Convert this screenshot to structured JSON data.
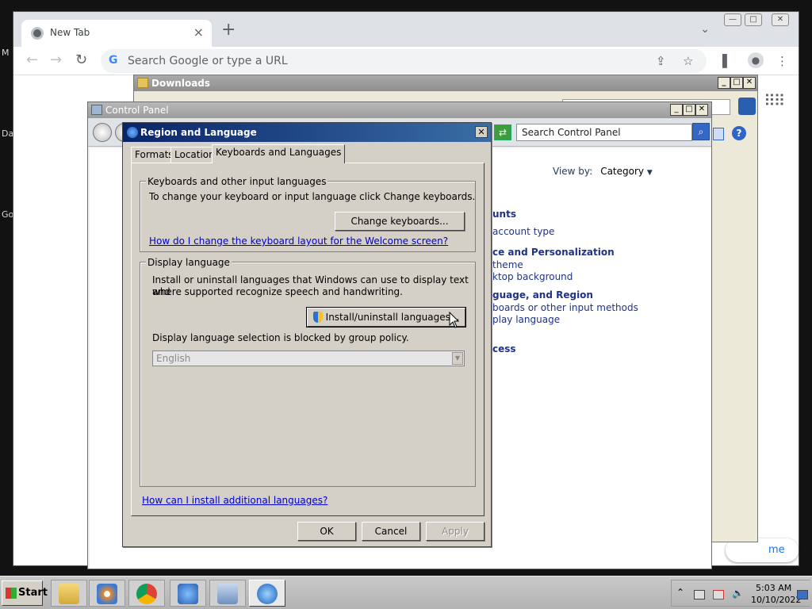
{
  "desktop": {
    "labels": [
      "M",
      "Da",
      "Go"
    ]
  },
  "chrome": {
    "tab_title": "New Tab",
    "new_tab": "+",
    "omnibox_placeholder": "Search Google or type a URL",
    "customize_label": "me"
  },
  "downloads": {
    "title": "Downloads"
  },
  "control_panel": {
    "title": "Control Panel",
    "search_placeholder": "Search Control Panel",
    "view_by_label": "View by:",
    "view_by_value": "Category",
    "items": [
      {
        "type": "category",
        "text": "unts"
      },
      {
        "type": "link",
        "text": "account type"
      },
      {
        "type": "category",
        "text": "ce and Personalization"
      },
      {
        "type": "link",
        "text": " theme"
      },
      {
        "type": "link",
        "text": "ktop background"
      },
      {
        "type": "category",
        "text": "guage, and Region"
      },
      {
        "type": "link",
        "text": "boards or other input methods"
      },
      {
        "type": "link",
        "text": "play language"
      },
      {
        "type": "category",
        "text": "cess"
      }
    ]
  },
  "dialog": {
    "title": "Region and Language",
    "tabs": [
      "Formats",
      "Location",
      "Keyboards and Languages"
    ],
    "active_tab": "Keyboards and Languages",
    "keyboards_group": {
      "label": "Keyboards and other input languages",
      "text": "To change your keyboard or input language click Change keyboards.",
      "button": "Change keyboards...",
      "link": "How do I change the keyboard layout for the Welcome screen?"
    },
    "display_group": {
      "label": "Display language",
      "text_line1": "Install or uninstall languages that Windows can use to display text and",
      "text_line2": "where supported recognize speech and handwriting.",
      "button": "Install/uninstall languages...",
      "blocked_text": "Display language selection is blocked by group policy.",
      "selected_language": "English"
    },
    "bottom_link": "How can I install additional languages?",
    "buttons": {
      "ok": "OK",
      "cancel": "Cancel",
      "apply": "Apply"
    }
  },
  "taskbar": {
    "start_label": "Start",
    "items": [
      "explorer",
      "media-player",
      "chrome",
      "control-panel-search",
      "control-panel",
      "region-globe"
    ],
    "time": "5:03 AM",
    "date": "10/10/2022"
  }
}
